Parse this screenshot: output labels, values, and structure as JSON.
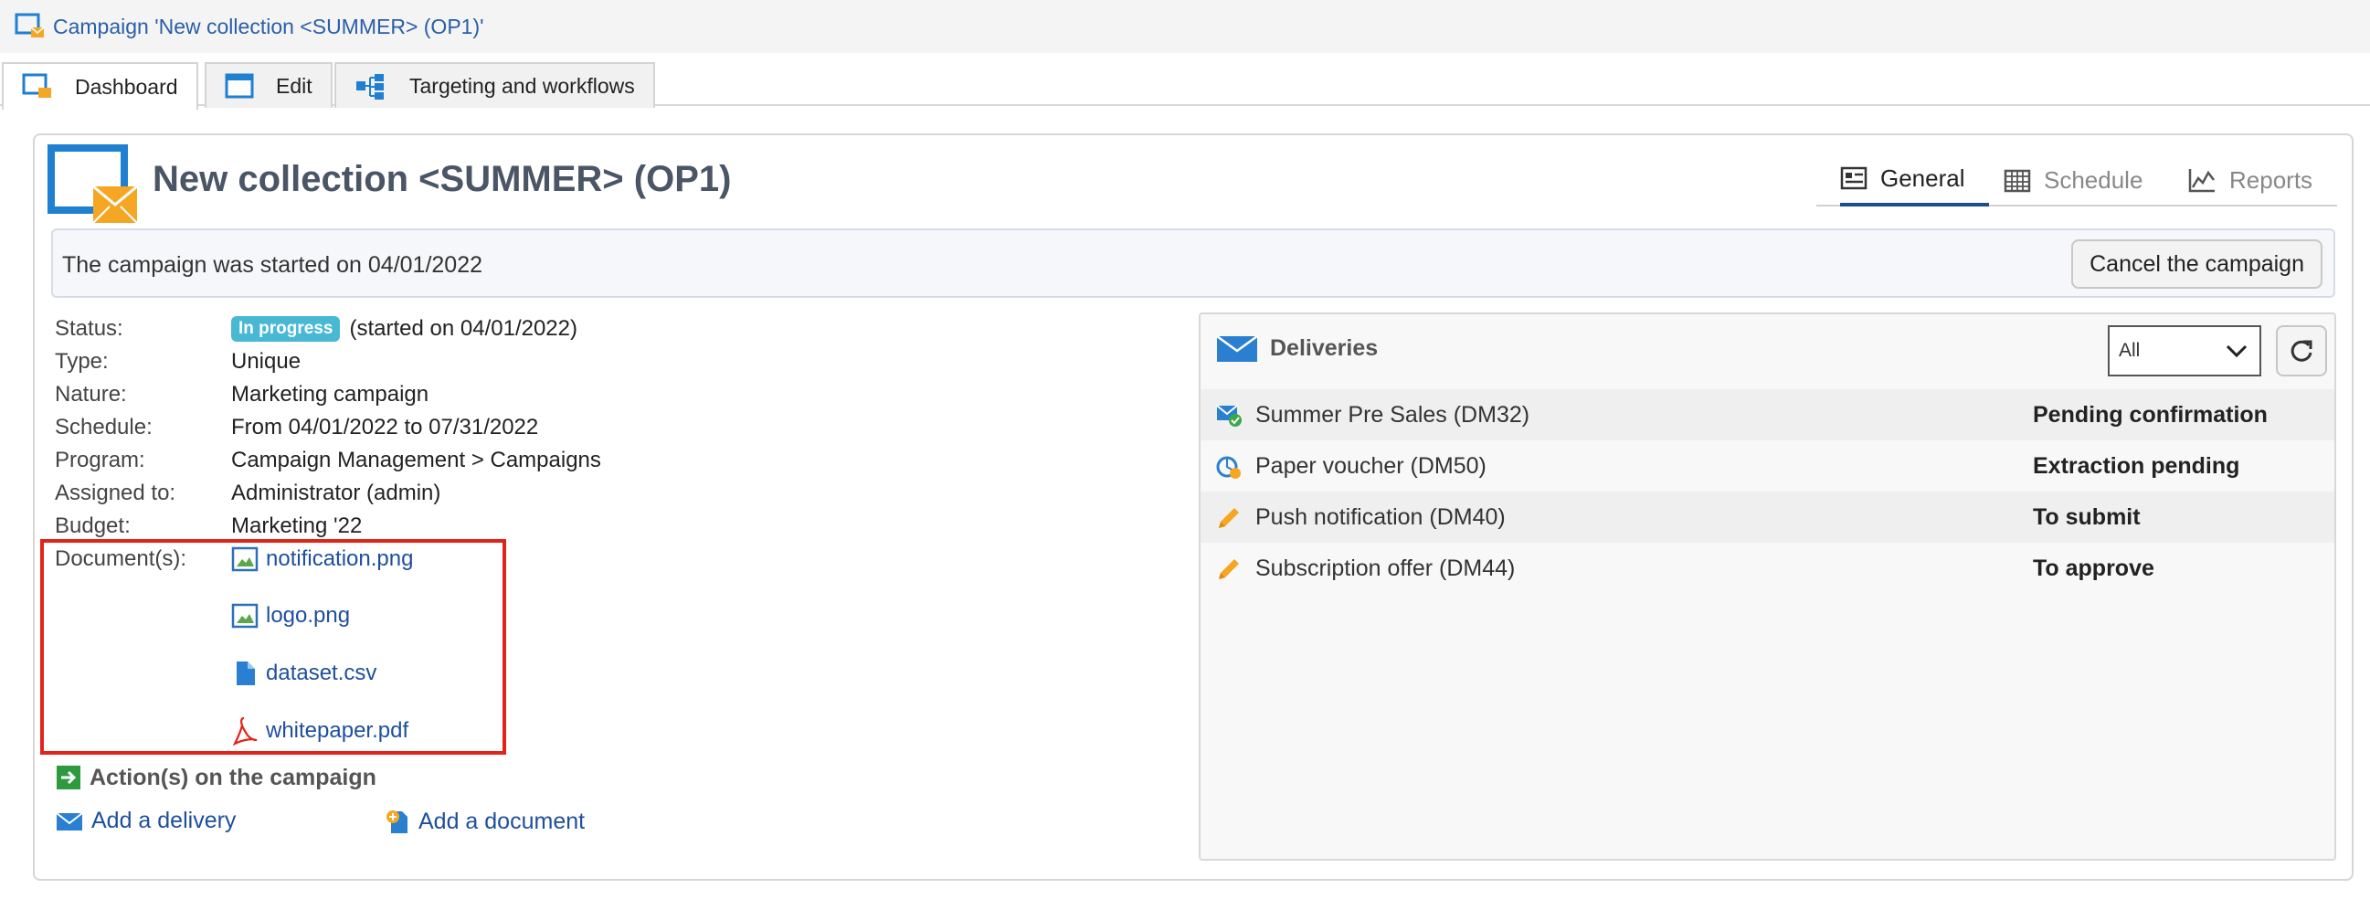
{
  "window": {
    "title": "Campaign 'New collection <SUMMER> (OP1)'"
  },
  "tabs": [
    {
      "label": "Dashboard",
      "icon": "dashboard-icon"
    },
    {
      "label": "Edit",
      "icon": "edit-window-icon"
    },
    {
      "label": "Targeting and workflows",
      "icon": "workflow-icon"
    }
  ],
  "page": {
    "title": "New collection <SUMMER> (OP1)"
  },
  "view_tabs": [
    {
      "label": "General",
      "icon": "general-icon"
    },
    {
      "label": "Schedule",
      "icon": "calendar-icon"
    },
    {
      "label": "Reports",
      "icon": "chart-line-icon"
    }
  ],
  "info": {
    "message": "The campaign was started on 04/01/2022",
    "cancel_label": "Cancel the campaign"
  },
  "details": {
    "status_label": "Status:",
    "status_badge": "In progress",
    "status_value": "(started on 04/01/2022)",
    "type_label": "Type:",
    "type_value": "Unique",
    "nature_label": "Nature:",
    "nature_value": "Marketing campaign",
    "schedule_label": "Schedule:",
    "schedule_value": "From 04/01/2022 to 07/31/2022",
    "program_label": "Program:",
    "program_value": "Campaign Management > Campaigns",
    "assigned_label": "Assigned to:",
    "assigned_value": "Administrator (admin)",
    "budget_label": "Budget:",
    "budget_value": "Marketing '22",
    "documents_label": "Document(s):"
  },
  "documents": [
    {
      "name": "notification.png",
      "icon": "image-file-icon"
    },
    {
      "name": "logo.png",
      "icon": "image-file-icon"
    },
    {
      "name": "dataset.csv",
      "icon": "file-icon"
    },
    {
      "name": "whitepaper.pdf",
      "icon": "pdf-icon"
    }
  ],
  "actions": {
    "heading": "Action(s) on the campaign",
    "add_delivery": "Add a delivery",
    "add_document": "Add a document"
  },
  "deliveries": {
    "heading": "Deliveries",
    "filter_value": "All",
    "rows": [
      {
        "name": "Summer Pre Sales (DM32)",
        "status": "Pending confirmation",
        "icon": "email-check-icon"
      },
      {
        "name": "Paper voucher (DM50)",
        "status": "Extraction pending",
        "icon": "direct-mail-icon"
      },
      {
        "name": "Push notification (DM40)",
        "status": "To submit",
        "icon": "pencil-icon"
      },
      {
        "name": "Subscription offer (DM44)",
        "status": "To approve",
        "icon": "pencil-icon"
      }
    ]
  },
  "colors": {
    "link": "#1e4f9c",
    "badge": "#48b8d4",
    "highlight_box": "#e2231a",
    "accent": "#1d4e8f"
  }
}
